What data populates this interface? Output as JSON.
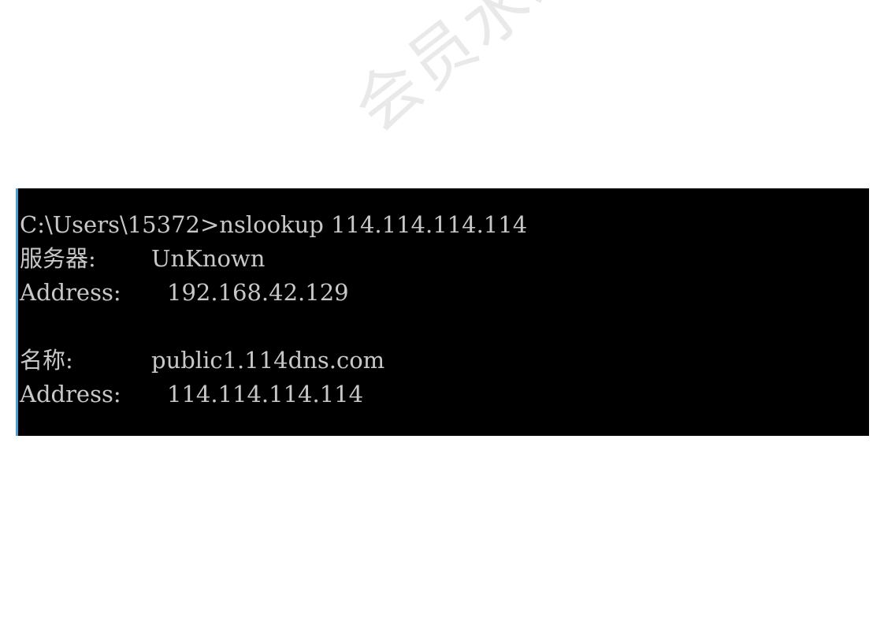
{
  "watermark": "会员水印",
  "terminal": {
    "prompt": "C:\\Users\\15372>",
    "command": "nslookup 114.114.114.114",
    "server_label": "服务器:",
    "server_value": "UnKnown",
    "server_address_label": "Address:",
    "server_address_value": "192.168.42.129",
    "name_label": "名称:",
    "name_value": "public1.114dns.com",
    "answer_address_label": "Address:",
    "answer_address_value": "114.114.114.114"
  }
}
